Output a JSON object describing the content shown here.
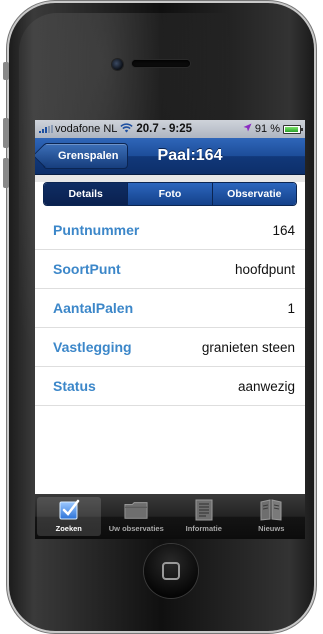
{
  "status_bar": {
    "carrier": "vodafone NL",
    "time": "20.7 - 9:25",
    "battery": "91 %",
    "battery_level": 0.91
  },
  "nav": {
    "back_label": "Grenspalen",
    "title": "Paal:164"
  },
  "segments": [
    {
      "label": "Details",
      "active": true
    },
    {
      "label": "Foto",
      "active": false
    },
    {
      "label": "Observatie",
      "active": false
    }
  ],
  "details": [
    {
      "label": "Puntnummer",
      "value": "164"
    },
    {
      "label": "SoortPunt",
      "value": "hoofdpunt"
    },
    {
      "label": "AantalPalen",
      "value": "1"
    },
    {
      "label": "Vastlegging",
      "value": "granieten steen"
    },
    {
      "label": "Status",
      "value": "aanwezig"
    }
  ],
  "tabs": [
    {
      "label": "Zoeken",
      "icon": "search-check-icon",
      "active": true
    },
    {
      "label": "Uw observaties",
      "icon": "folder-icon",
      "active": false
    },
    {
      "label": "Informatie",
      "icon": "document-icon",
      "active": false
    },
    {
      "label": "Nieuws",
      "icon": "newspaper-icon",
      "active": false
    }
  ],
  "colors": {
    "nav_blue": "#1d4d99",
    "label_blue": "#3c87c9",
    "tabbar_dark": "#141414"
  }
}
